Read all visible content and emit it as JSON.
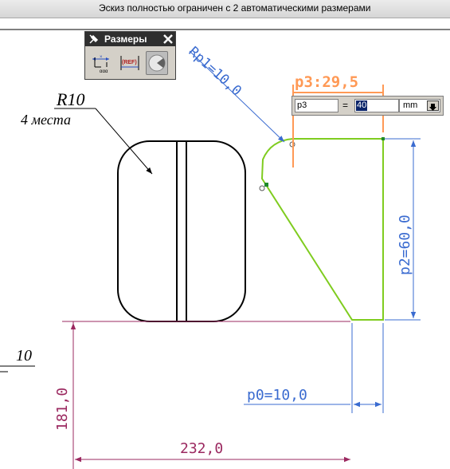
{
  "status_bar": {
    "text": "Эскиз полностью ограничен с 2 автоматическими размерами"
  },
  "palette": {
    "title": "Размеры",
    "buttons": [
      {
        "name": "linear-dimension",
        "label": "",
        "sublabel": "ααα"
      },
      {
        "name": "reference-dimension",
        "label": "(REF)"
      },
      {
        "name": "auto-dimension",
        "label": ""
      }
    ]
  },
  "dimension_editor": {
    "name_value": "p3",
    "equals": "=",
    "value": "40",
    "unit": "mm"
  },
  "annotations": {
    "fillet_radius": "R10",
    "fillet_count": "4 места",
    "rp1": "Rp1=10,0",
    "p3": "p3:29,5",
    "p2": "p2=60,0",
    "p0": "p0=10,0",
    "left_partial": "10",
    "vertical_dim": "181,0",
    "horizontal_dim": "232,0"
  },
  "colors": {
    "sketch_green": "#7fcc1f",
    "dimension_blue": "#3a6bd0",
    "active_orange": "#ff9955",
    "reference_magenta": "#9b2960",
    "geometry_black": "#000000"
  }
}
